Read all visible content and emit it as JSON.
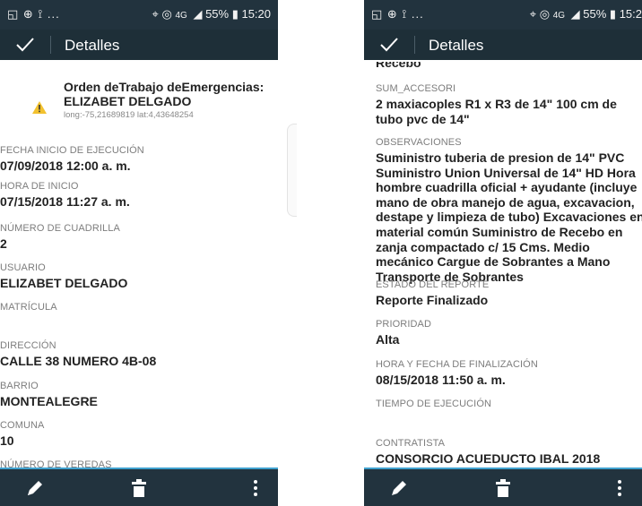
{
  "left": {
    "status": {
      "left_icons": "◱ ⊕ ⟟ ...",
      "right_text": "55% ▮ 15:20",
      "network": "4G"
    },
    "app_bar": {
      "title": "Detalles"
    },
    "order": {
      "title_line1": "Orden deTrabajo deEmergencias:",
      "title_line2": "ELIZABET DELGADO",
      "coords": "long:-75,21689819 lat:4,43648254"
    },
    "fields": [
      {
        "label": "FECHA INICIO DE EJECUCIÓN",
        "value": "07/09/2018 12:00 a. m."
      },
      {
        "label": "HORA DE INICIO",
        "value": "07/15/2018 11:27 a. m."
      },
      {
        "label": "NÚMERO DE CUADRILLA",
        "value": "2"
      },
      {
        "label": "USUARIO",
        "value": "ELIZABET DELGADO"
      },
      {
        "label": "MATRÍCULA",
        "value": ""
      },
      {
        "label": "DIRECCIÓN",
        "value": "CALLE 38 NUMERO 4B-08"
      },
      {
        "label": "BARRIO",
        "value": "MONTEALEGRE"
      },
      {
        "label": "COMUNA",
        "value": "10"
      },
      {
        "label": "NÚMERO DE VEREDAS",
        "value": ""
      }
    ]
  },
  "right": {
    "status": {
      "left_icons": "◱ ⊕ ⟟ ...",
      "right_text": "55% ▮ 15:2",
      "network": "4G"
    },
    "app_bar": {
      "title": "Detalles"
    },
    "clipped_top_value": "Recebo",
    "fields": [
      {
        "label": "SUM_ACCESORI",
        "value": "2 maxiacoples R1 x R3 de 14\" 100 cm de tubo pvc de 14\""
      },
      {
        "label": "OBSERVACIONES",
        "value": "Suministro tuberia de presion de 14\" PVC Suministro Union Universal de 14\" HD Hora hombre cuadrilla oficial + ayudante (incluye mano de obra manejo de agua, excavacion, destape y limpieza de tubo) Excavaciones en material común Suministro de Recebo en zanja compactado c/ 15 Cms. Medio mecánico Cargue de Sobrantes a Mano Transporte de Sobrantes"
      },
      {
        "label": "ESTADO DEL REPORTE",
        "value": "Reporte Finalizado"
      },
      {
        "label": "PRIORIDAD",
        "value": "Alta"
      },
      {
        "label": "HORA Y FECHA DE FINALIZACIÓN",
        "value": "08/15/2018 11:50 a. m."
      },
      {
        "label": "TIEMPO DE EJECUCIÓN",
        "value": ""
      },
      {
        "label": "CONTRATISTA",
        "value": "CONSORCIO ACUEDUCTO IBAL 2018"
      }
    ]
  },
  "colors": {
    "app_bar": "#1e2f38",
    "status_bar": "#22333e",
    "accent": "#3fa1cf",
    "warning": "#f2c12e"
  },
  "icons": {
    "confirm": "check-icon",
    "edit": "pencil-icon",
    "delete": "trash-icon",
    "more": "overflow-menu-icon",
    "warning": "warning-icon"
  }
}
